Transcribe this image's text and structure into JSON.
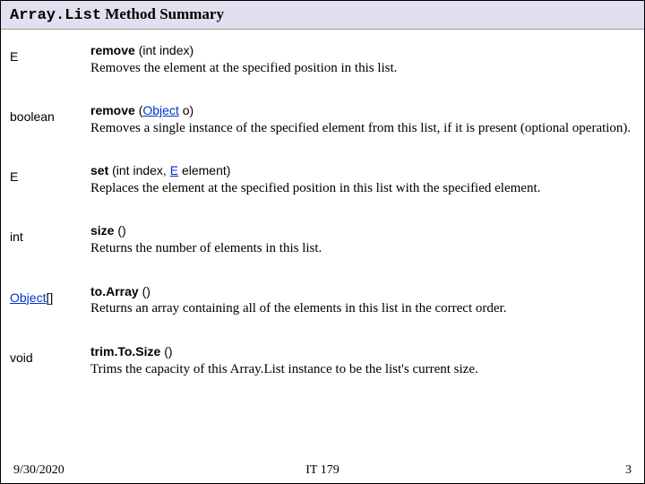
{
  "title": {
    "prefix": "Array.List",
    "suffix": " Method Summary"
  },
  "methods": [
    {
      "ret": "E",
      "name": "remove",
      "params": " (int index)",
      "desc": "Removes the element at the specified position in this list."
    },
    {
      "ret": "boolean",
      "name": "remove",
      "params_prefix": " (",
      "params_link": "Object",
      "params_suffix": " o)",
      "desc": "Removes a single instance of the specified element from this list, if it is present (optional operation)."
    },
    {
      "ret": "E",
      "name": "set",
      "params_prefix": " (int index, ",
      "params_link": "E",
      "params_suffix": " element)",
      "desc": "Replaces the element at the specified position in this list with the specified element."
    },
    {
      "ret": "int",
      "name": "size",
      "params": " ()",
      "desc": "Returns the number of elements in this list."
    },
    {
      "ret_link": "Object",
      "ret_suffix": "[]",
      "name": "to.Array",
      "params": " ()",
      "desc": "Returns an array containing all of the elements in this list in the correct order."
    },
    {
      "ret": "void",
      "name": "trim.To.Size",
      "params": " ()",
      "desc": "Trims the capacity of this Array.List  instance to be the list's current size."
    }
  ],
  "footer": {
    "left": "9/30/2020",
    "center": "IT 179",
    "right": "3"
  }
}
